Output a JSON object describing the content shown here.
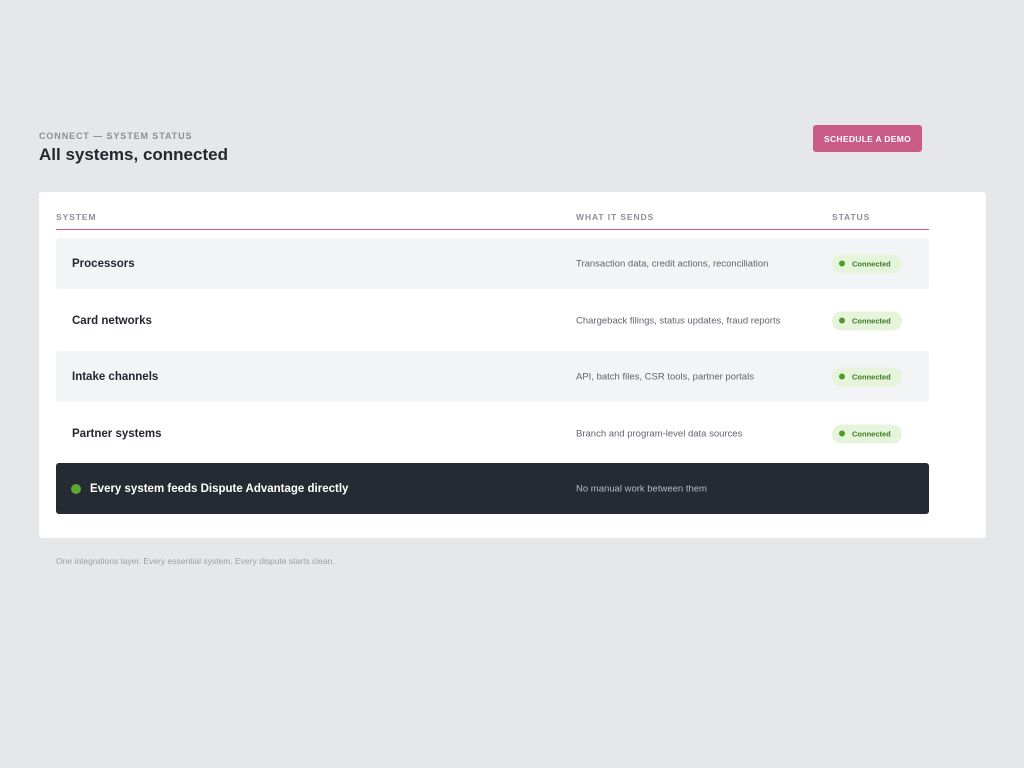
{
  "header": {
    "eyebrow": "CONNECT — SYSTEM STATUS",
    "title": "All systems, connected",
    "cta_label": "SCHEDULE A DEMO"
  },
  "table": {
    "columns": [
      "SYSTEM",
      "WHAT IT SENDS",
      "STATUS"
    ],
    "rows": [
      {
        "system": "Processors",
        "sends": "Transaction data, credit actions, reconciliation",
        "status": "Connected"
      },
      {
        "system": "Card networks",
        "sends": "Chargeback filings, status updates, fraud reports",
        "status": "Connected"
      },
      {
        "system": "Intake channels",
        "sends": "API, batch files, CSR tools, partner portals",
        "status": "Connected"
      },
      {
        "system": "Partner systems",
        "sends": "Branch and program-level data sources",
        "status": "Connected"
      }
    ],
    "summary": {
      "label": "Every system feeds Dispute Advantage directly",
      "detail": "No manual work between them"
    }
  },
  "footnote": "One integrations layer. Every essential system. Every dispute starts clean.",
  "colors": {
    "accent": "#c95c87",
    "status_bg": "#e6f4dc",
    "status_text": "#3c7a22",
    "summary_bg": "#252a33"
  }
}
